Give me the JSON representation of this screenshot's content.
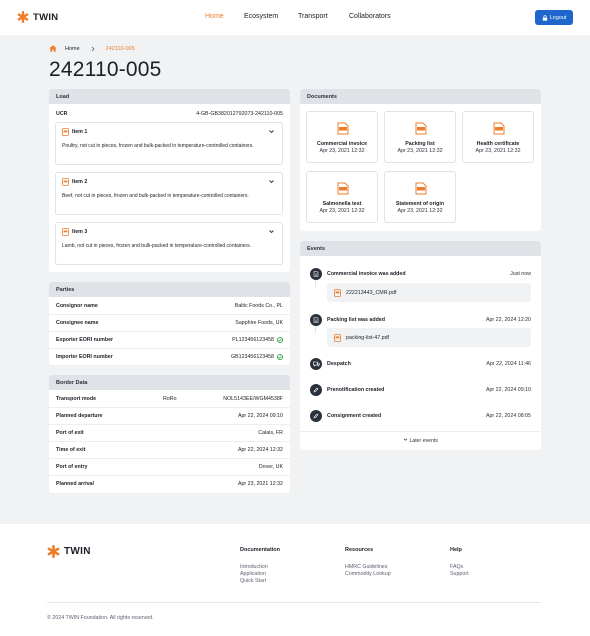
{
  "brand": {
    "name": "TWIN",
    "accent": "#ee7d2b",
    "primary": "#1e66cc"
  },
  "nav": [
    {
      "label": "Home",
      "active": true
    },
    {
      "label": "Ecosystem",
      "active": false
    },
    {
      "label": "Transport",
      "active": false
    },
    {
      "label": "Collaborators",
      "active": false
    }
  ],
  "logout": {
    "label": "Logout",
    "icon": "lock-icon"
  },
  "breadcrumb": {
    "home": "Home",
    "current": "242110-005"
  },
  "page": {
    "title": "242110-005"
  },
  "load": {
    "header": "Load",
    "ucr_label": "UCR",
    "ucr_value": "4-GB-GB382012792073-242110-005",
    "items": [
      {
        "title": "Item 1",
        "description": "Poultry, not cut in pieces, frozen and bulk-packed in temperature-controlled containers."
      },
      {
        "title": "Item 2",
        "description": "Beef, not cut in pieces, frozen and bulk-packed in temperature-controlled containers."
      },
      {
        "title": "Item 3",
        "description": "Lamb, not cut in pieces, frozen and bulk-packed in temperature-controlled containers."
      }
    ]
  },
  "parties": {
    "header": "Parties",
    "rows": [
      {
        "label": "Consignor name",
        "value": "Baltic Foods Co., PL",
        "verified": false
      },
      {
        "label": "Consignee name",
        "value": "Sapphire Foods, UK",
        "verified": false
      },
      {
        "label": "Exporter EORI number",
        "value": "PL123456123458",
        "verified": true
      },
      {
        "label": "Importer EORI number",
        "value": "GB123456123458",
        "verified": true
      }
    ]
  },
  "border": {
    "header": "Border Data",
    "rows": [
      {
        "label": "Transport mode",
        "mid": "RoRo",
        "value": "NOL5143EE/WGM4538F"
      },
      {
        "label": "Planned departure",
        "mid": "",
        "value": "Apr 22, 2024 09:10"
      },
      {
        "label": "Port of exit",
        "mid": "",
        "value": "Calais, FR"
      },
      {
        "label": "Time of exit",
        "mid": "",
        "value": "Apr 22, 2024 12:32"
      },
      {
        "label": "Port of entry",
        "mid": "",
        "value": "Dover, UK"
      },
      {
        "label": "Planned arrival",
        "mid": "",
        "value": "Apr 23, 2021 12:32"
      }
    ]
  },
  "documents": {
    "header": "Documents",
    "items": [
      {
        "name": "Commercial invoice",
        "date": "Apr 23, 2021 12:32"
      },
      {
        "name": "Packing list",
        "date": "Apr 23, 2021 12:32"
      },
      {
        "name": "Health certificate",
        "date": "Apr 23, 2021 12:32"
      },
      {
        "name": "Salmonella test",
        "date": "Apr 23, 2021 12:32"
      },
      {
        "name": "Statement of origin",
        "date": "Apr 23, 2021 12:32"
      }
    ]
  },
  "events": {
    "header": "Events",
    "items": [
      {
        "title": "Commercial invoice was added",
        "time": "Just now",
        "file": "222213443_CMR.pdf",
        "icon": "document-icon"
      },
      {
        "title": "Packing list was added",
        "time": "Apr 22, 2024 12:20",
        "file": "packing-list-47.pdf",
        "icon": "document-icon"
      },
      {
        "title": "Despatch",
        "time": "Apr 22, 2024 11:46",
        "file": "",
        "icon": "truck-icon"
      },
      {
        "title": "Prenotification created",
        "time": "Apr 22, 2024 09:10",
        "file": "",
        "icon": "pencil-icon"
      },
      {
        "title": "Consignment created",
        "time": "Apr 22, 2024 08:05",
        "file": "",
        "icon": "pencil-icon"
      }
    ],
    "later_label": "Later events"
  },
  "footer": {
    "columns": [
      {
        "heading": "Documentation",
        "links": [
          "Introduction",
          "Application",
          "Quick Start"
        ]
      },
      {
        "heading": "Resources",
        "links": [
          "HMRC Guidelines",
          "Commodity Lookup"
        ]
      },
      {
        "heading": "Help",
        "links": [
          "FAQs",
          "Support"
        ]
      }
    ],
    "copyright": "© 2024 TWIN Foundation. All rights reserved."
  }
}
